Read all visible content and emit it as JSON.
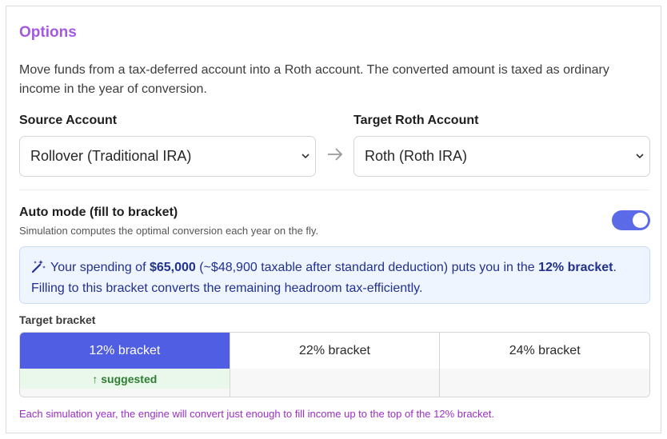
{
  "panel": {
    "title": "Options",
    "description": "Move funds from a tax-deferred account into a Roth account. The converted amount is taxed as ordinary income in the year of conversion."
  },
  "source": {
    "label": "Source Account",
    "selected": "Rollover (Traditional IRA)"
  },
  "target": {
    "label": "Target Roth Account",
    "selected": "Roth (Roth IRA)"
  },
  "auto_mode": {
    "title": "Auto mode (fill to bracket)",
    "subtitle": "Simulation computes the optimal conversion each year on the fly.",
    "enabled": true
  },
  "info": {
    "icon": "magic-wand-icon",
    "prefix": "Your spending of ",
    "spending": "$65,000",
    "middle": " (~$48,900 taxable after standard deduction) puts you in the ",
    "bracket": "12% bracket",
    "suffix": ". Filling to this bracket converts the remaining headroom tax-efficiently."
  },
  "target_bracket": {
    "label": "Target bracket",
    "options": [
      {
        "label": "12% bracket",
        "note": "↑ suggested"
      },
      {
        "label": "22% bracket",
        "note": ""
      },
      {
        "label": "24% bracket",
        "note": ""
      }
    ],
    "selected_index": 0
  },
  "footnote": "Each simulation year, the engine will convert just enough to fill income up to the top of the 12% bracket.",
  "colors": {
    "accent": "#4f5ee3",
    "title": "#a45ae0",
    "suggested": "#2e7d32",
    "footnote": "#9b2fc9"
  }
}
